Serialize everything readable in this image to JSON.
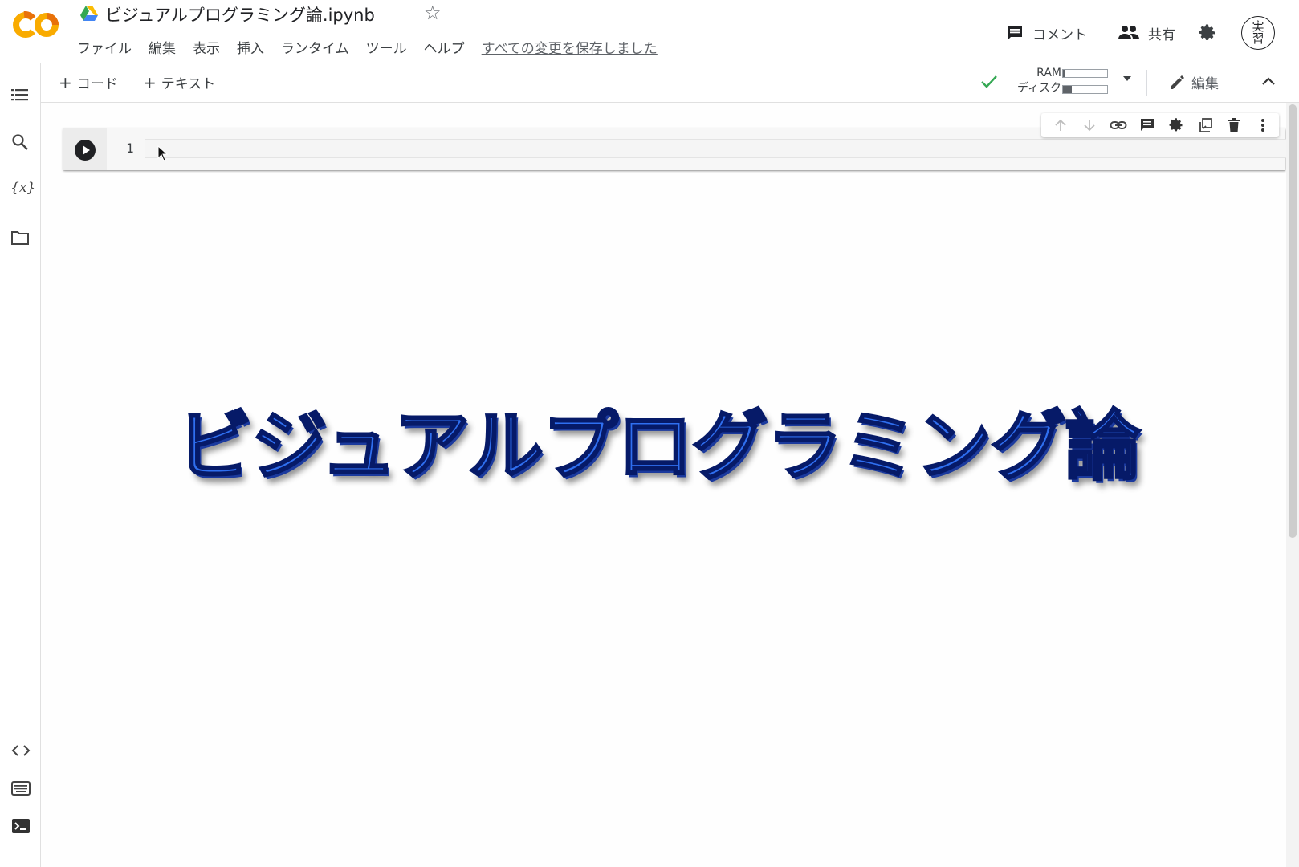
{
  "header": {
    "title": "ビジュアルプログラミング論.ipynb",
    "menu": [
      "ファイル",
      "編集",
      "表示",
      "挿入",
      "ランタイム",
      "ツール",
      "ヘルプ"
    ],
    "save_status": "すべての変更を保存しました",
    "comment_label": "コメント",
    "share_label": "共有",
    "avatar_line1": "実",
    "avatar_line2": "習"
  },
  "toolbar": {
    "add_code": "コード",
    "add_text": "テキスト",
    "ram_label": "RAM",
    "disk_label": "ディスク",
    "ram_usage": 0.05,
    "disk_usage": 0.2,
    "edit_label": "編集"
  },
  "cell": {
    "line_number": "1",
    "code": ""
  },
  "main": {
    "heading": "ビジュアルプログラミング論"
  },
  "colors": {
    "logo_orange": "#f9ab00",
    "logo_dark": "#e8710a",
    "heading_fill": "#2f6ff0",
    "heading_outline": "#061a68",
    "check_green": "#34a853"
  },
  "icons": [
    "colab-logo",
    "drive-icon",
    "star-icon",
    "comment-icon",
    "people-icon",
    "gear-icon",
    "toc-icon",
    "search-icon",
    "variables-icon",
    "folder-icon",
    "code-snippets-icon",
    "command-palette-icon",
    "terminal-icon",
    "check-icon",
    "chevron-down-icon",
    "pencil-icon",
    "chevron-up-icon",
    "play-icon",
    "arrow-up-icon",
    "arrow-down-icon",
    "link-icon",
    "comment-icon",
    "gear-icon",
    "mirror-cell-icon",
    "trash-icon",
    "more-vert-icon",
    "mouse-cursor-icon"
  ]
}
